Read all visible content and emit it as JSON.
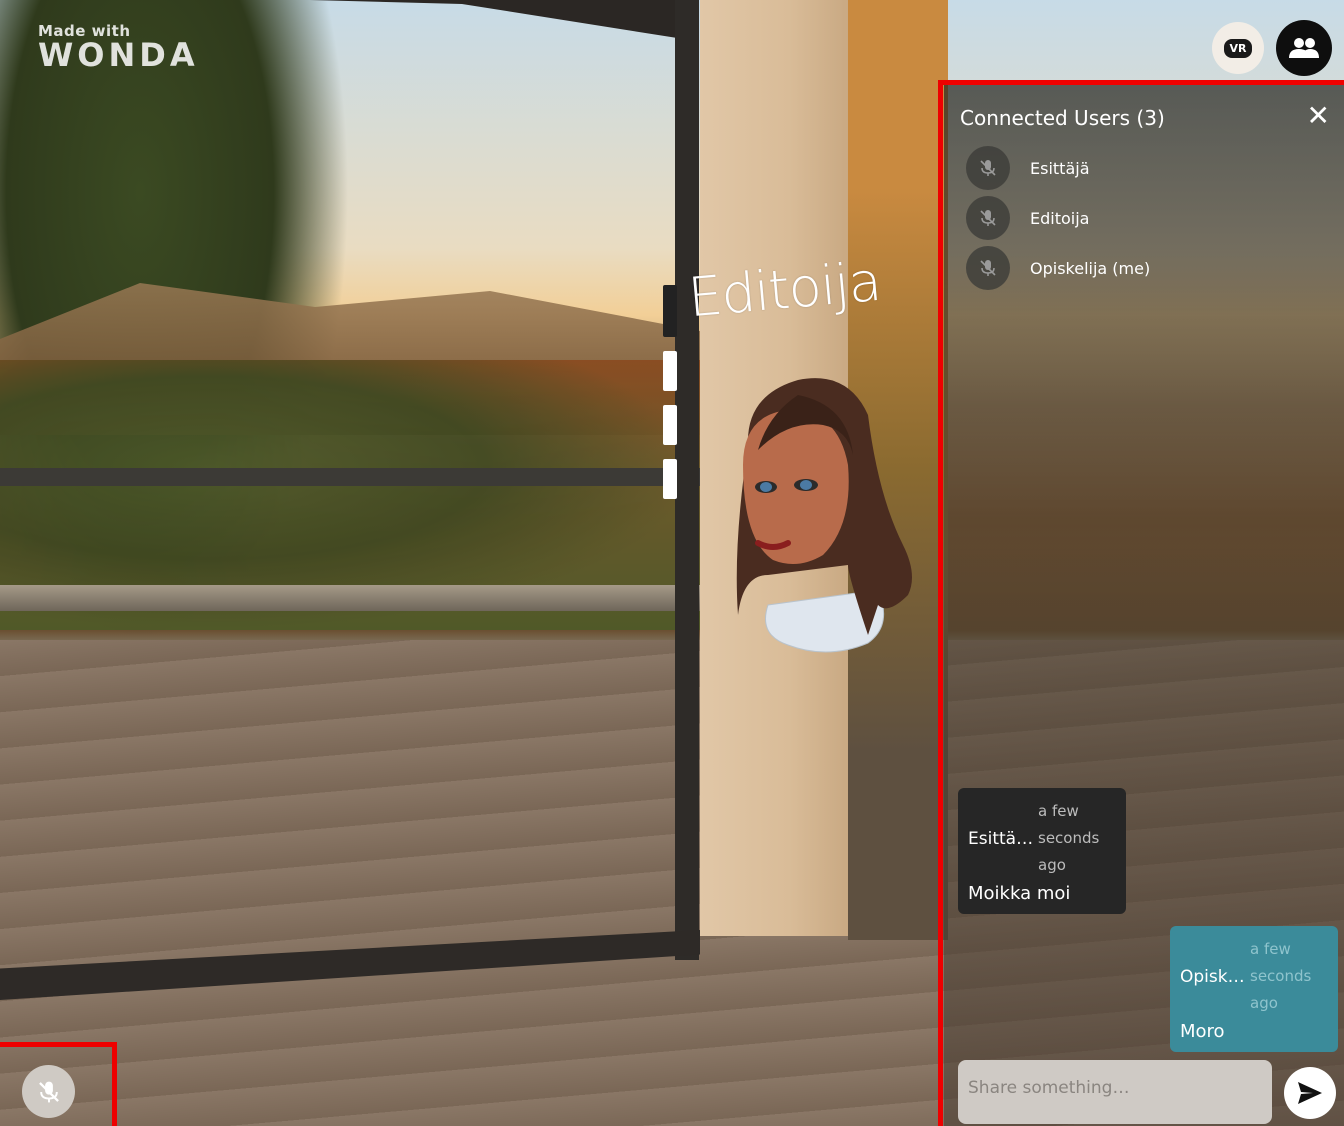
{
  "watermark": {
    "made_with": "Made with",
    "brand": "WONDA"
  },
  "scene": {
    "avatar_label": "Editoija"
  },
  "header": {
    "vr_label": "VR",
    "vr_icon": "vr-headset-icon",
    "users_icon": "users-icon"
  },
  "panel": {
    "title": "Connected Users (3)",
    "close_symbol": "✕",
    "users": [
      {
        "name": "Esittäjä",
        "mic_icon": "mic-off-icon"
      },
      {
        "name": "Editoija",
        "mic_icon": "mic-off-icon"
      },
      {
        "name": "Opiskelija (me)",
        "mic_icon": "mic-off-icon"
      }
    ],
    "messages": [
      {
        "author": "Esittä…",
        "time": "a few seconds ago",
        "text": "Moikka moi",
        "direction": "incoming"
      },
      {
        "author": "Opisk…",
        "time": "a few seconds ago",
        "text": "Moro",
        "direction": "outgoing"
      }
    ],
    "input_placeholder": "Share something…",
    "send_icon": "send-icon"
  },
  "footer": {
    "mic_icon": "mic-off-icon"
  },
  "colors": {
    "highlight": "#ee0000",
    "outgoing_bubble": "#3b8b9a",
    "incoming_bubble": "#262626"
  }
}
